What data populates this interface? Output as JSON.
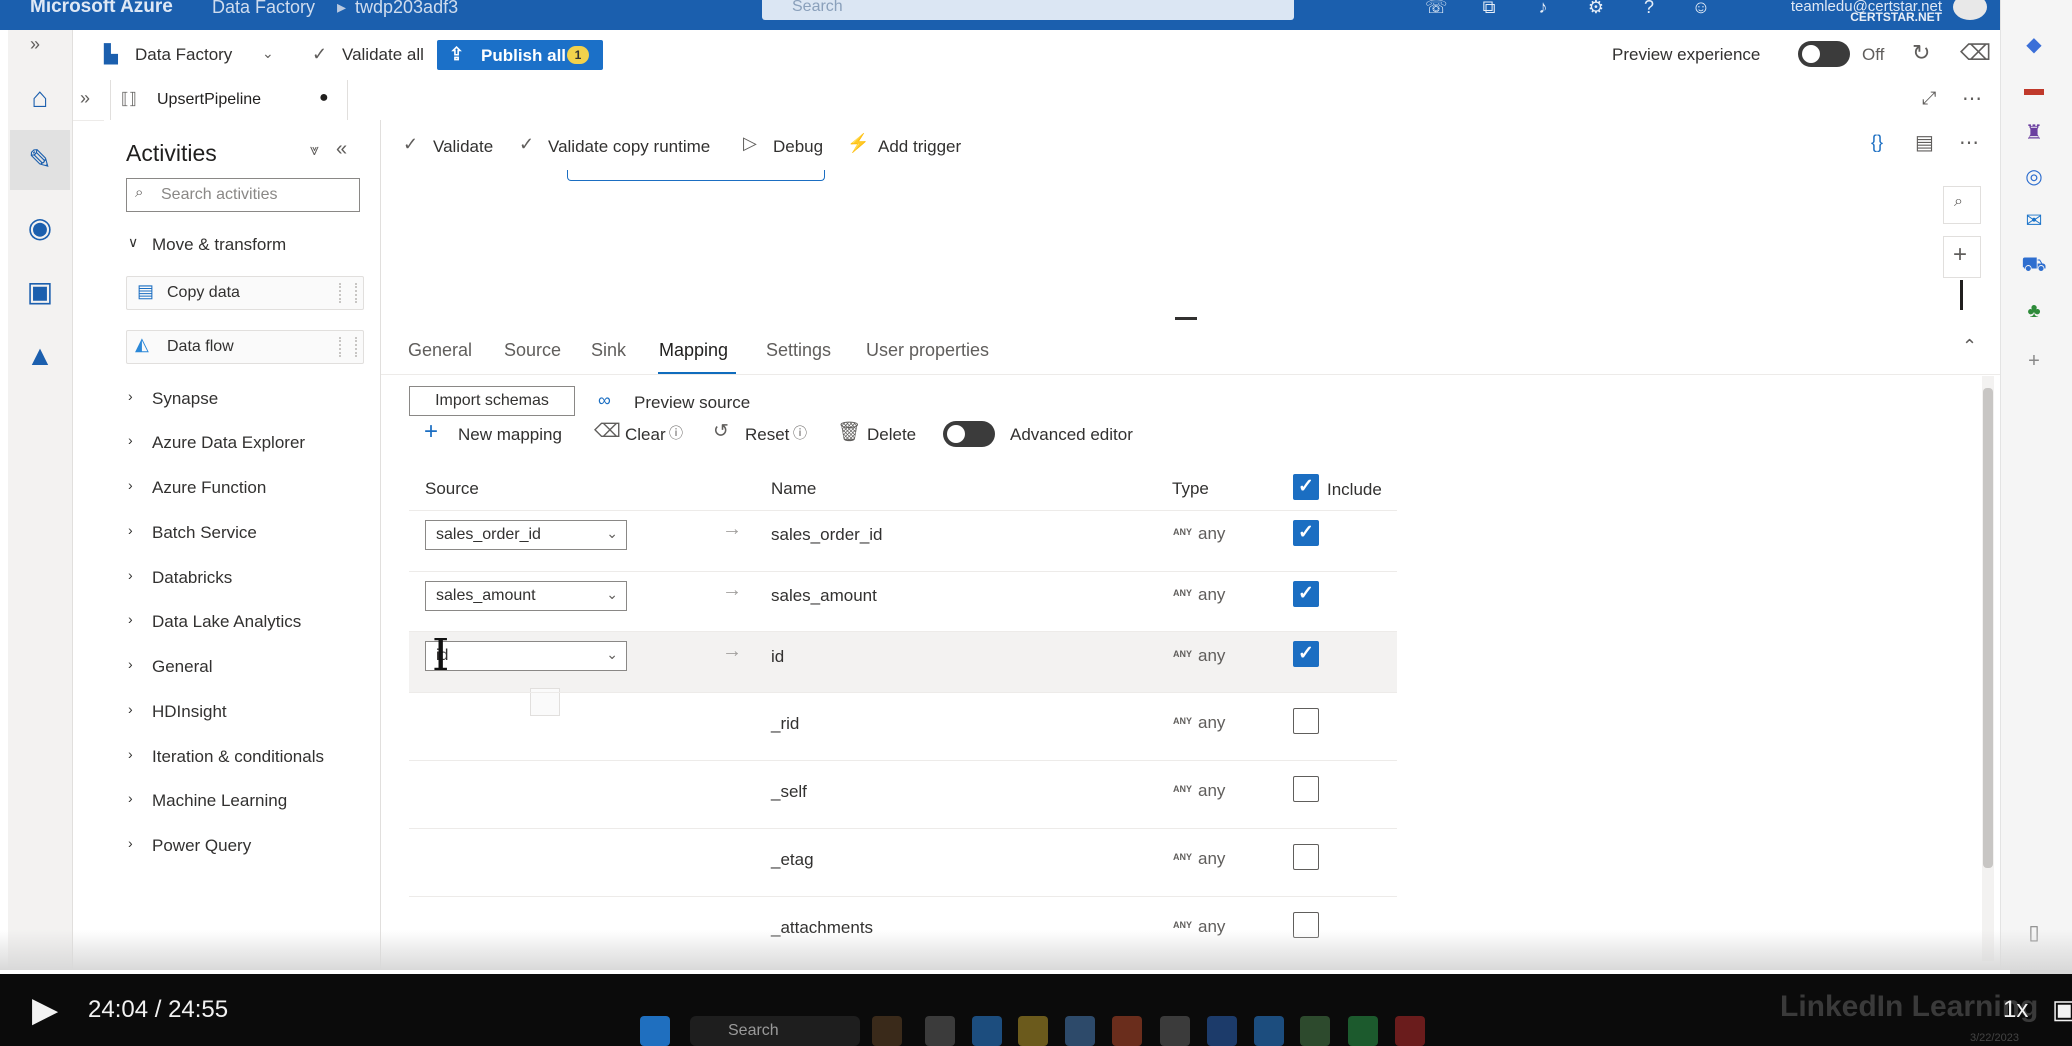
{
  "topbar": {
    "brand": "Microsoft Azure",
    "crumb1": "Data Factory",
    "crumb2": "twdp203adf3",
    "search_placeholder": "Search",
    "user_email": "teamledu@certstar.net",
    "user_org": "CERTSTAR.NET"
  },
  "factorybar": {
    "factory_label": "Data Factory",
    "validate_all": "Validate all",
    "publish_all": "Publish all",
    "publish_badge": "1",
    "preview_label": "Preview experience",
    "preview_state": "Off"
  },
  "tab": {
    "pipeline_name": "UpsertPipeline",
    "dirty_marker": "●"
  },
  "activities": {
    "title": "Activities",
    "search_placeholder": "Search activities",
    "move_transform": "Move & transform",
    "copy_data": "Copy data",
    "data_flow": "Data flow",
    "categories": [
      "Synapse",
      "Azure Data Explorer",
      "Azure Function",
      "Batch Service",
      "Databricks",
      "Data Lake Analytics",
      "General",
      "HDInsight",
      "Iteration & conditionals",
      "Machine Learning",
      "Power Query"
    ]
  },
  "canvas_toolbar": {
    "validate": "Validate",
    "validate_copy_runtime": "Validate copy runtime",
    "debug": "Debug",
    "add_trigger": "Add trigger"
  },
  "props": {
    "tabs": [
      "General",
      "Source",
      "Sink",
      "Mapping",
      "Settings",
      "User properties"
    ],
    "active_tab": "Mapping",
    "import_schemas": "Import schemas",
    "preview_source": "Preview source",
    "new_mapping": "New mapping",
    "clear": "Clear",
    "reset": "Reset",
    "delete": "Delete",
    "advanced_editor": "Advanced editor",
    "headers": {
      "source": "Source",
      "name": "Name",
      "type": "Type",
      "include": "Include"
    },
    "rows": [
      {
        "source": "sales_order_id",
        "name": "sales_order_id",
        "type_badge": "ANY",
        "type": "any",
        "include": true
      },
      {
        "source": "sales_amount",
        "name": "sales_amount",
        "type_badge": "ANY",
        "type": "any",
        "include": true
      },
      {
        "source": "id",
        "name": "id",
        "type_badge": "ANY",
        "type": "any",
        "include": true
      },
      {
        "source": "",
        "name": "_rid",
        "type_badge": "ANY",
        "type": "any",
        "include": false
      },
      {
        "source": "",
        "name": "_self",
        "type_badge": "ANY",
        "type": "any",
        "include": false
      },
      {
        "source": "",
        "name": "_etag",
        "type_badge": "ANY",
        "type": "any",
        "include": false
      },
      {
        "source": "",
        "name": "_attachments",
        "type_badge": "ANY",
        "type": "any",
        "include": false
      }
    ]
  },
  "player": {
    "timecode": "24:04 / 24:55",
    "speed": "1x",
    "watermark": "LinkedIn Learning",
    "date": "3/22/2023",
    "taskbar_search": "Search",
    "progress": 0.97
  }
}
